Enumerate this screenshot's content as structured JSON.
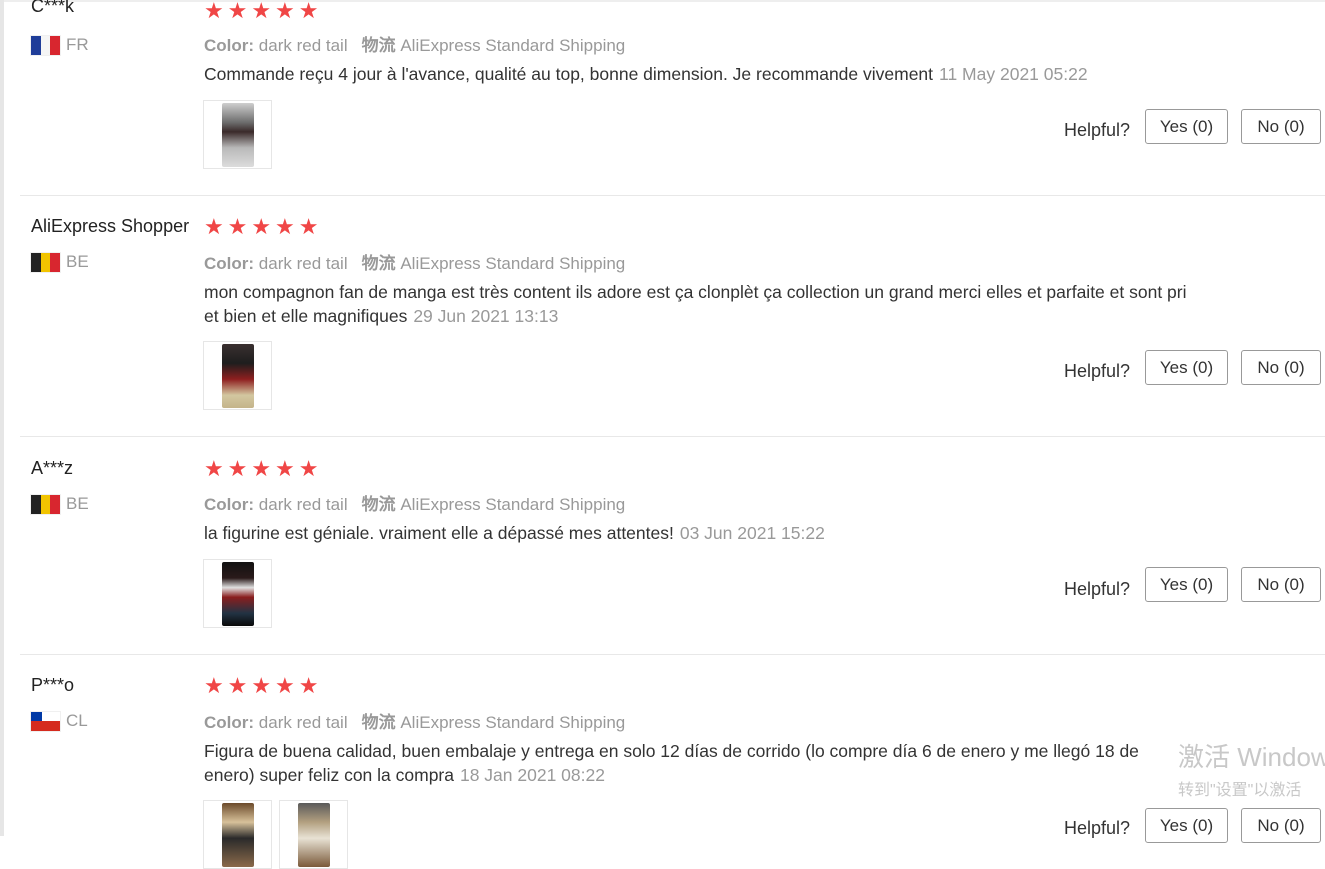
{
  "labels": {
    "color": "Color:",
    "shipping": "物流",
    "helpful": "Helpful?",
    "yes": "Yes (0)",
    "no": "No (0)"
  },
  "star_color": "#f04646",
  "reviews": [
    {
      "user": "C***k",
      "country": "FR",
      "rating": 5,
      "color_value": "dark red tail",
      "shipping_value": "AliExpress Standard Shipping",
      "text": "Commande reçu 4 jour à l'avance, qualité au top, bonne dimension. Je recommande vivement",
      "date": "11 May 2021 05:22"
    },
    {
      "user": "AliExpress Shopper",
      "country": "BE",
      "rating": 5,
      "color_value": "dark red tail",
      "shipping_value": "AliExpress Standard Shipping",
      "text": "mon compagnon fan de manga est très content ils adore est ça clonplèt ça collection un grand merci elles et parfaite et sont pri et bien et elle magnifiques",
      "date": "29 Jun 2021 13:13"
    },
    {
      "user": "A***z",
      "country": "BE",
      "rating": 5,
      "color_value": "dark red tail",
      "shipping_value": "AliExpress Standard Shipping",
      "text": "la figurine est géniale. vraiment elle a dépassé mes attentes!",
      "date": "03 Jun 2021 15:22"
    },
    {
      "user": "P***o",
      "country": "CL",
      "rating": 5,
      "color_value": "dark red tail",
      "shipping_value": "AliExpress Standard Shipping",
      "text": "Figura de buena calidad, buen embalaje y entrega en solo 12 días de corrido (lo compre día 6 de enero y me llegó 18 de enero) super feliz con la compra",
      "date": "18 Jan 2021 08:22"
    }
  ],
  "watermark": {
    "line1": "激活 Window",
    "line2": "转到\"设置\"以激活"
  }
}
